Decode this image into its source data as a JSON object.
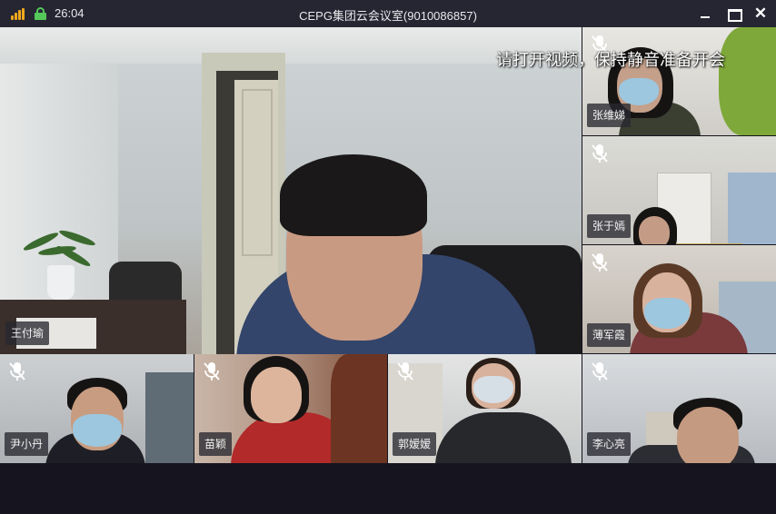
{
  "window": {
    "title": "CEPG集团云会议室(9010086857)",
    "elapsed": "26:04",
    "signal_icon": "signal-strength-icon",
    "lock_icon": "lock-icon",
    "minimize_icon": "minimize-icon",
    "maximize_icon": "maximize-icon",
    "close_label": "✕",
    "colors": {
      "titlebar": "#262633",
      "signal": "#f0a81c",
      "lock": "#55c85a",
      "background": "#15141f"
    }
  },
  "main_video": {
    "participant": "王付瑜",
    "caption": "请打开视频，保持静音准备开会"
  },
  "side_videos": [
    {
      "participant": "张维娣",
      "muted": true
    },
    {
      "participant": "张于嫣",
      "muted": true
    },
    {
      "participant": "薄军霞",
      "muted": true
    }
  ],
  "bottom_videos": [
    {
      "participant": "尹小丹",
      "muted": true
    },
    {
      "participant": "苗颖",
      "muted": true
    },
    {
      "participant": "郭嫒嫒",
      "muted": true
    },
    {
      "participant": "李心亮",
      "muted": true
    }
  ],
  "icons": {
    "muted_mic": "mic-off-icon"
  }
}
